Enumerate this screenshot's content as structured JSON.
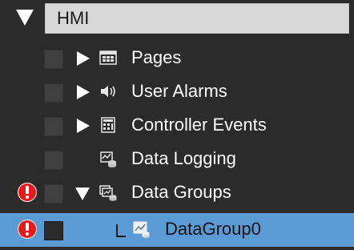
{
  "tree": {
    "root": {
      "label": "HMI"
    },
    "items": [
      {
        "label": "Pages",
        "icon": "pages-icon"
      },
      {
        "label": "User Alarms",
        "icon": "speaker-icon"
      },
      {
        "label": "Controller Events",
        "icon": "controller-events-icon"
      },
      {
        "label": "Data Logging",
        "icon": "data-logging-icon"
      },
      {
        "label": "Data Groups",
        "icon": "data-groups-icon"
      },
      {
        "label": "DataGroup0",
        "icon": "data-group-icon"
      }
    ]
  },
  "colors": {
    "background": "#2b2b2b",
    "header_bg": "#d8d8d8",
    "selection": "#5b9bd5",
    "error": "#e81a1a"
  }
}
